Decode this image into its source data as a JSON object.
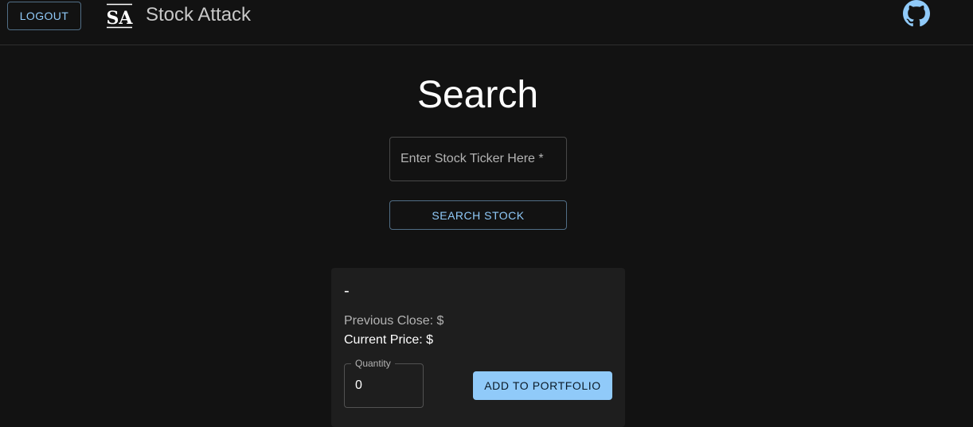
{
  "header": {
    "logout_label": "LOGOUT",
    "logo_text": "SA",
    "brand_name": "Stock Attack",
    "github_icon": "github-icon"
  },
  "search": {
    "title": "Search",
    "ticker_placeholder": "Enter Stock Ticker Here *",
    "ticker_value": "",
    "button_label": "SEARCH STOCK"
  },
  "stock_card": {
    "name": "-",
    "previous_close": "Previous Close: $",
    "current_price": "Current Price: $",
    "quantity_label": "Quantity",
    "quantity_value": "0",
    "add_button_label": "ADD TO PORTFOLIO"
  },
  "colors": {
    "background": "#121212",
    "card": "#1e1e1e",
    "accent": "#90caf9"
  }
}
